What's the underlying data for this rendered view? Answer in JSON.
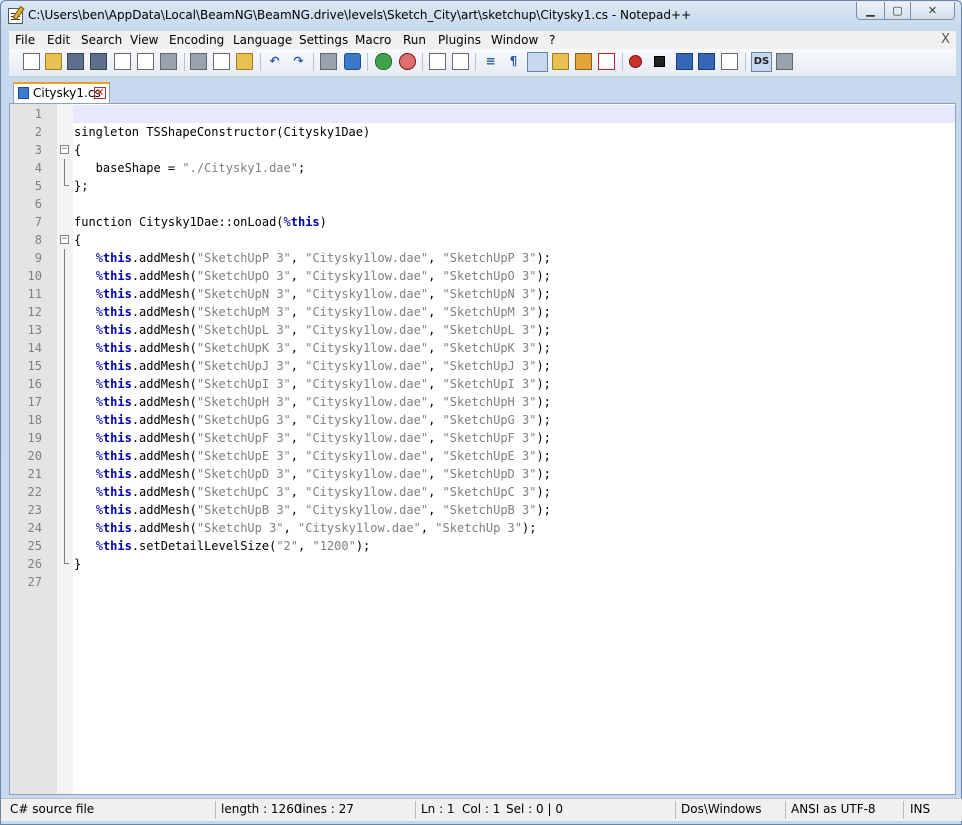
{
  "window": {
    "title": "C:\\Users\\ben\\AppData\\Local\\BeamNG\\BeamNG.drive\\levels\\Sketch_City\\art\\sketchup\\Citysky1.cs - Notepad++",
    "icon": "notepadpp-icon",
    "controls": {
      "minimize": "minimize-icon",
      "maximize": "maximize-icon",
      "close": "close-icon"
    }
  },
  "menu": {
    "items": [
      "File",
      "Edit",
      "Search",
      "View",
      "Encoding",
      "Language",
      "Settings",
      "Macro",
      "Run",
      "Plugins",
      "Window",
      "?"
    ],
    "close_label": "X"
  },
  "toolbar": {
    "icons": [
      "new-file-icon",
      "open-file-icon",
      "save-icon",
      "save-all-icon",
      "close-icon",
      "close-all-icon",
      "print-icon",
      "cut-icon",
      "copy-icon",
      "paste-icon",
      "undo-icon",
      "redo-icon",
      "find-icon",
      "replace-icon",
      "zoom-in-icon",
      "zoom-out-icon",
      "sync-vertical-icon",
      "sync-horizontal-icon",
      "word-wrap-icon",
      "show-all-chars-icon",
      "indent-guide-icon",
      "udl-icon",
      "doc-map-icon",
      "function-list-icon",
      "record-macro-icon",
      "stop-macro-icon",
      "play-macro-icon",
      "run-macro-multiple-icon",
      "save-macro-icon",
      "doc-switcher-icon",
      "spell-check-icon"
    ],
    "ds_label": "DS"
  },
  "tabs": [
    {
      "label": "Citysky1.cs",
      "active": true
    }
  ],
  "editor": {
    "current_line": 1,
    "lines": [
      {
        "n": "1",
        "text": ""
      },
      {
        "n": "2",
        "text": "singleton TSShapeConstructor(Citysky1Dae)"
      },
      {
        "n": "3",
        "text": "{"
      },
      {
        "n": "4",
        "text": "   baseShape = \"./Citysky1.dae\";"
      },
      {
        "n": "5",
        "text": "};"
      },
      {
        "n": "6",
        "text": ""
      },
      {
        "n": "7",
        "text": "function Citysky1Dae::onLoad(%this)"
      },
      {
        "n": "8",
        "text": "{"
      },
      {
        "n": "9",
        "text": "   %this.addMesh(\"SketchUpP 3\", \"Citysky1low.dae\", \"SketchUpP 3\");"
      },
      {
        "n": "10",
        "text": "   %this.addMesh(\"SketchUpO 3\", \"Citysky1low.dae\", \"SketchUpO 3\");"
      },
      {
        "n": "11",
        "text": "   %this.addMesh(\"SketchUpN 3\", \"Citysky1low.dae\", \"SketchUpN 3\");"
      },
      {
        "n": "12",
        "text": "   %this.addMesh(\"SketchUpM 3\", \"Citysky1low.dae\", \"SketchUpM 3\");"
      },
      {
        "n": "13",
        "text": "   %this.addMesh(\"SketchUpL 3\", \"Citysky1low.dae\", \"SketchUpL 3\");"
      },
      {
        "n": "14",
        "text": "   %this.addMesh(\"SketchUpK 3\", \"Citysky1low.dae\", \"SketchUpK 3\");"
      },
      {
        "n": "15",
        "text": "   %this.addMesh(\"SketchUpJ 3\", \"Citysky1low.dae\", \"SketchUpJ 3\");"
      },
      {
        "n": "16",
        "text": "   %this.addMesh(\"SketchUpI 3\", \"Citysky1low.dae\", \"SketchUpI 3\");"
      },
      {
        "n": "17",
        "text": "   %this.addMesh(\"SketchUpH 3\", \"Citysky1low.dae\", \"SketchUpH 3\");"
      },
      {
        "n": "18",
        "text": "   %this.addMesh(\"SketchUpG 3\", \"Citysky1low.dae\", \"SketchUpG 3\");"
      },
      {
        "n": "19",
        "text": "   %this.addMesh(\"SketchUpF 3\", \"Citysky1low.dae\", \"SketchUpF 3\");"
      },
      {
        "n": "20",
        "text": "   %this.addMesh(\"SketchUpE 3\", \"Citysky1low.dae\", \"SketchUpE 3\");"
      },
      {
        "n": "21",
        "text": "   %this.addMesh(\"SketchUpD 3\", \"Citysky1low.dae\", \"SketchUpD 3\");"
      },
      {
        "n": "22",
        "text": "   %this.addMesh(\"SketchUpC 3\", \"Citysky1low.dae\", \"SketchUpC 3\");"
      },
      {
        "n": "23",
        "text": "   %this.addMesh(\"SketchUpB 3\", \"Citysky1low.dae\", \"SketchUpB 3\");"
      },
      {
        "n": "24",
        "text": "   %this.addMesh(\"SketchUp 3\", \"Citysky1low.dae\", \"SketchUp 3\");"
      },
      {
        "n": "25",
        "text": "   %this.setDetailLevelSize(\"2\", \"1200\");"
      },
      {
        "n": "26",
        "text": "}"
      },
      {
        "n": "27",
        "text": ""
      }
    ]
  },
  "status": {
    "file_type": "C# source file",
    "length": "length : 1260",
    "lines": "lines : 27",
    "ln": "Ln : 1",
    "col": "Col : 1",
    "sel": "Sel : 0 | 0",
    "eol": "Dos\\Windows",
    "encoding": "ANSI as UTF-8",
    "mode": "INS"
  }
}
